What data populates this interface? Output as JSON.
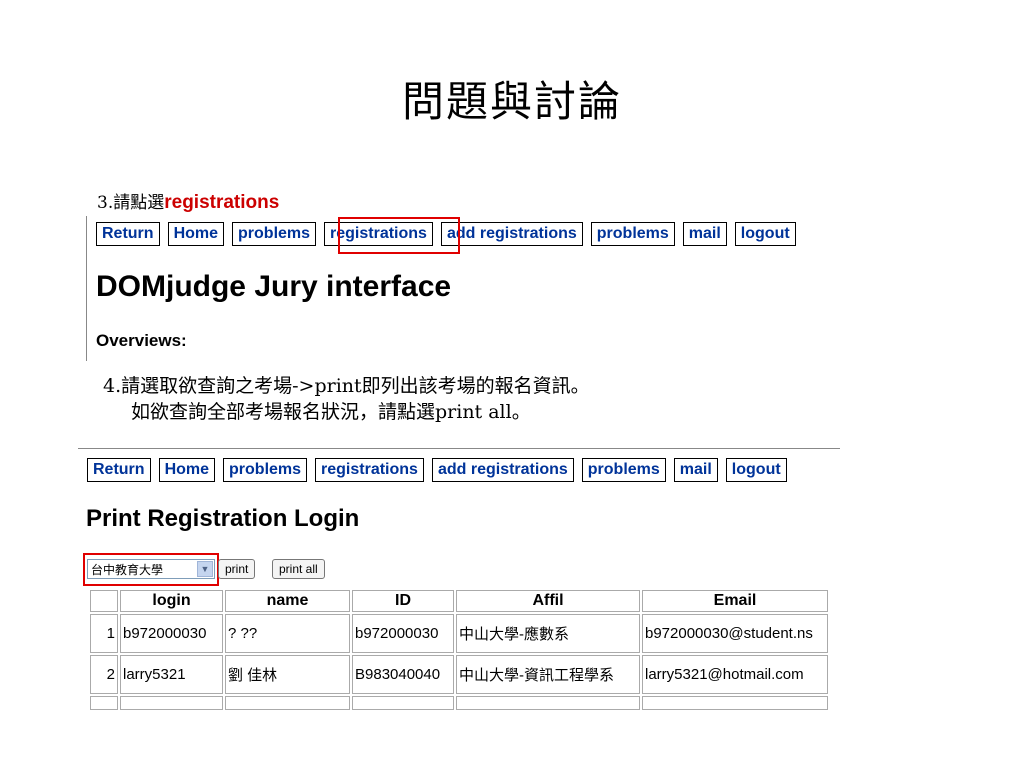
{
  "slide": {
    "title": "問題與討論",
    "step3_prefix": "3.請點選",
    "step3_highlight": "registrations",
    "step4_line1": "4.請選取欲查詢之考場->print即列出該考場的報名資訊。",
    "step4_line2": "如欲查詢全部考場報名狀況，請點選print all。"
  },
  "nav": {
    "return": "Return",
    "home": "Home",
    "problems": "problems",
    "registrations": "registrations",
    "add_registrations": "add registrations",
    "problems2": "problems",
    "mail": "mail",
    "logout": "logout"
  },
  "jury": {
    "heading": "DOMjudge Jury interface",
    "overviews": "Overviews:"
  },
  "print_page": {
    "heading": "Print Registration Login",
    "select_value": "台中教育大學",
    "print_label": "print",
    "print_all_label": "print all"
  },
  "table": {
    "headers": [
      "",
      "login",
      "name",
      "ID",
      "Affil",
      "Email"
    ],
    "rows": [
      {
        "n": "1",
        "login": "b972000030",
        "name": "? ??",
        "id": "b972000030",
        "affil": "中山大學-應數系",
        "email": "b972000030@student.ns"
      },
      {
        "n": "2",
        "login": "larry5321",
        "name": "劉 佳林",
        "id": "B983040040",
        "affil": "中山大學-資訊工程學系",
        "email": "larry5321@hotmail.com"
      }
    ]
  },
  "colors": {
    "highlight_red": "#e00000",
    "nav_link": "#003399"
  }
}
